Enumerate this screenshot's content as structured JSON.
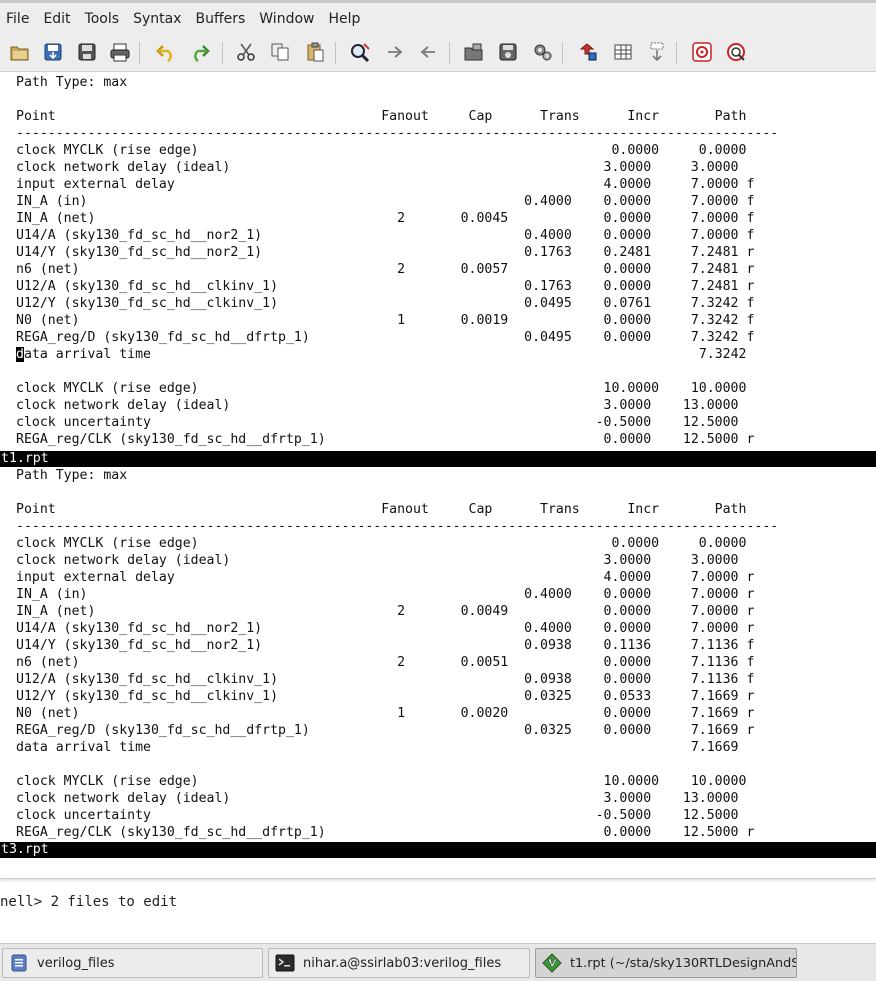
{
  "menu": [
    "File",
    "Edit",
    "Tools",
    "Syntax",
    "Buffers",
    "Window",
    "Help"
  ],
  "toolbar": [
    "open-icon",
    "save-icon",
    "save-all-icon",
    "print-icon",
    "undo-icon",
    "redo-icon",
    "cut-icon",
    "copy-icon",
    "paste-icon",
    "find-replace-icon",
    "find-next-icon",
    "find-prev-icon",
    "load-session-icon",
    "save-session-icon",
    "run-script-icon",
    "make-icon",
    "run-ctags-icon",
    "jump-tag-icon",
    "help-icon",
    "find-help-icon"
  ],
  "pane1": {
    "lines": [
      "Path Type: max",
      "",
      "Point                                         Fanout     Cap      Trans      Incr       Path",
      "------------------------------------------------------------------------------------------------",
      "clock MYCLK (rise edge)                                                    0.0000     0.0000",
      "clock network delay (ideal)                                               3.0000     3.0000",
      "input external delay                                                      4.0000     7.0000 f",
      "IN_A (in)                                                       0.4000    0.0000     7.0000 f",
      "IN_A (net)                                      2       0.0045            0.0000     7.0000 f",
      "U14/A (sky130_fd_sc_hd__nor2_1)                                 0.4000    0.0000     7.0000 f",
      "U14/Y (sky130_fd_sc_hd__nor2_1)                                 0.1763    0.2481     7.2481 r",
      "n6 (net)                                        2       0.0057            0.0000     7.2481 r",
      "U12/A (sky130_fd_sc_hd__clkinv_1)                               0.1763    0.0000     7.2481 r",
      "U12/Y (sky130_fd_sc_hd__clkinv_1)                               0.0495    0.0761     7.3242 f",
      "N0 (net)                                        1       0.0019            0.0000     7.3242 f",
      "REGA_reg/D (sky130_fd_sc_hd__dfrtp_1)                           0.0495    0.0000     7.3242 f",
      "ata arrival time                                                                     7.3242",
      "",
      "clock MYCLK (rise edge)                                                   10.0000    10.0000",
      "clock network delay (ideal)                                               3.0000    13.0000",
      "clock uncertainty                                                        -0.5000    12.5000",
      "REGA_reg/CLK (sky130_fd_sc_hd__dfrtp_1)                                   0.0000    12.5000 r"
    ],
    "cursor_char": "d",
    "status": "t1.rpt"
  },
  "pane2": {
    "lines": [
      "Path Type: max",
      "",
      "Point                                         Fanout     Cap      Trans      Incr       Path",
      "------------------------------------------------------------------------------------------------",
      "clock MYCLK (rise edge)                                                    0.0000     0.0000",
      "clock network delay (ideal)                                               3.0000     3.0000",
      "input external delay                                                      4.0000     7.0000 r",
      "IN_A (in)                                                       0.4000    0.0000     7.0000 r",
      "IN_A (net)                                      2       0.0049            0.0000     7.0000 r",
      "U14/A (sky130_fd_sc_hd__nor2_1)                                 0.4000    0.0000     7.0000 r",
      "U14/Y (sky130_fd_sc_hd__nor2_1)                                 0.0938    0.1136     7.1136 f",
      "n6 (net)                                        2       0.0051            0.0000     7.1136 f",
      "U12/A (sky130_fd_sc_hd__clkinv_1)                               0.0938    0.0000     7.1136 f",
      "U12/Y (sky130_fd_sc_hd__clkinv_1)                               0.0325    0.0533     7.1669 r",
      "N0 (net)                                        1       0.0020            0.0000     7.1669 r",
      "REGA_reg/D (sky130_fd_sc_hd__dfrtp_1)                           0.0325    0.0000     7.1669 r",
      "data arrival time                                                                    7.1669",
      "",
      "clock MYCLK (rise edge)                                                   10.0000    10.0000",
      "clock network delay (ideal)                                               3.0000    13.0000",
      "clock uncertainty                                                        -0.5000    12.5000",
      "REGA_reg/CLK (sky130_fd_sc_hd__dfrtp_1)                                   0.0000    12.5000 r"
    ],
    "status": "t3.rpt"
  },
  "terminal": {
    "text": "nell> 2 files to edit"
  },
  "taskbar": {
    "items": [
      {
        "label": "verilog_files",
        "icon": "file-manager-icon"
      },
      {
        "label": "nihar.a@ssirlab03:verilog_files",
        "icon": "terminal-icon"
      },
      {
        "label": "t1.rpt (~/sta/sky130RTLDesignAndS…",
        "icon": "gvim-icon"
      }
    ]
  }
}
